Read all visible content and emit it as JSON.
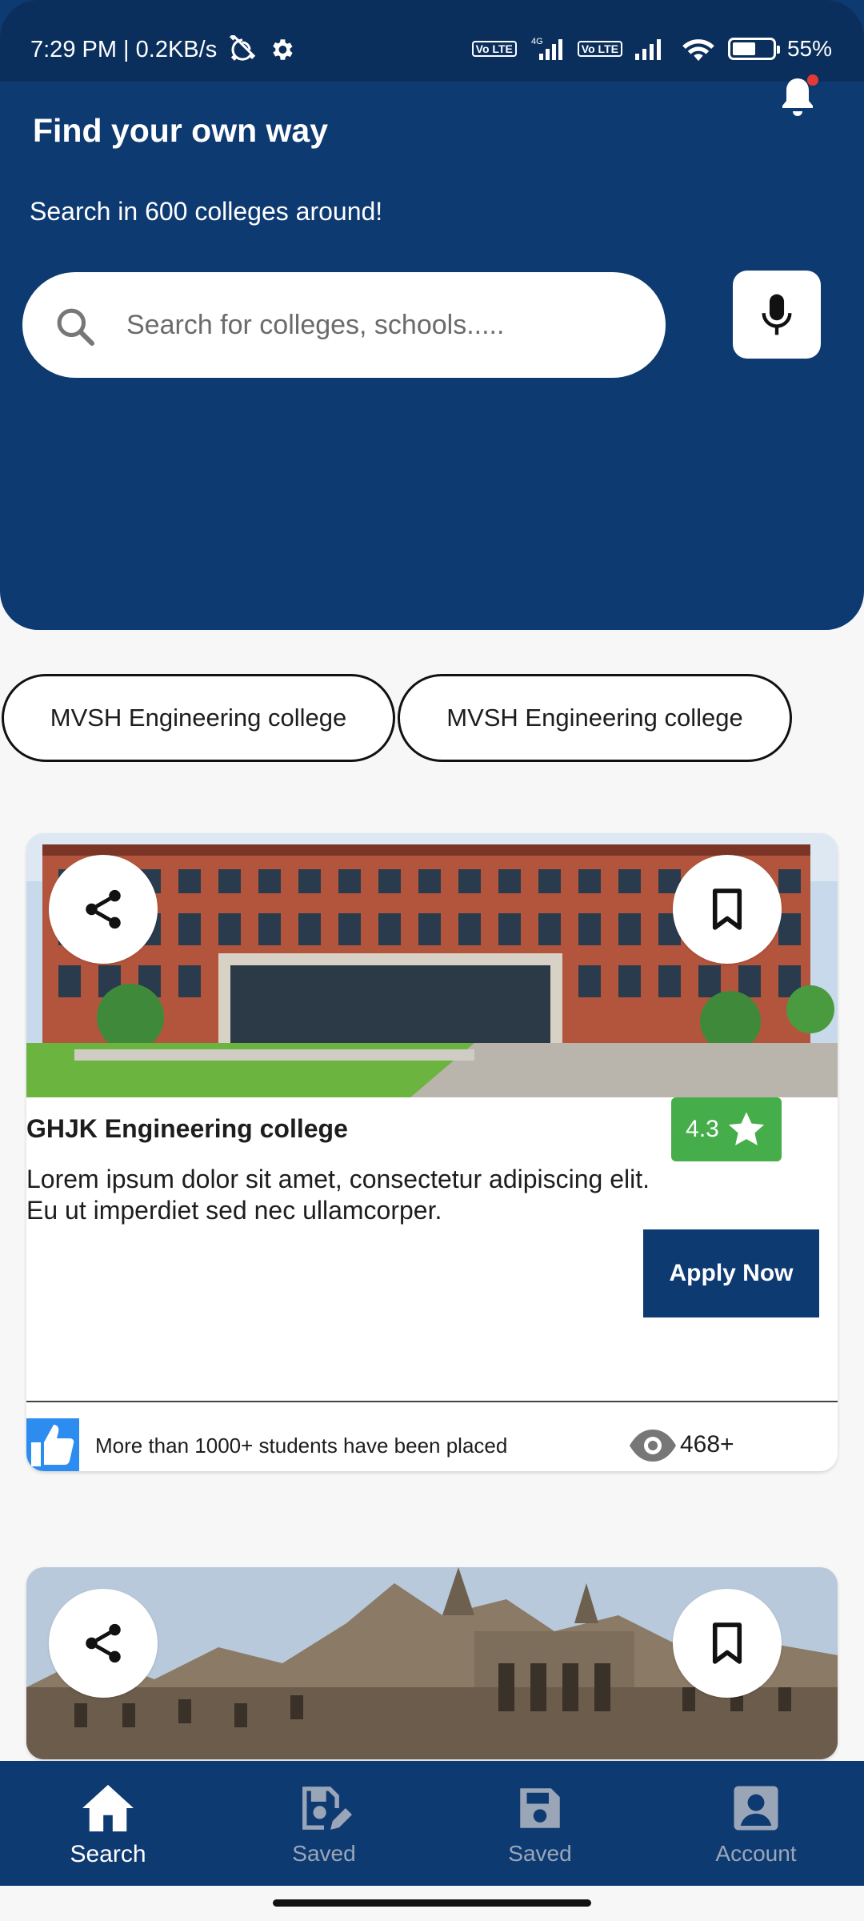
{
  "status_bar": {
    "time_speed": "7:29 PM | 0.2KB/s",
    "network_4g": "4G",
    "volte_1": "Vo LTE",
    "volte_2": "Vo LTE",
    "battery_percent": "55%",
    "battery_level": 0.55
  },
  "header": {
    "title": "Find your own way",
    "subtitle": "Search in 600 colleges around!",
    "search_placeholder": "Search for colleges, schools.....",
    "background_color": "#0e3a72"
  },
  "chips": [
    {
      "label": "MVSH Engineering college"
    },
    {
      "label": "MVSH Engineering college"
    }
  ],
  "cards": [
    {
      "name": "GHJK Engineering college",
      "rating": "4.3",
      "description": "Lorem ipsum dolor sit amet, consectetur adipiscing elit. Eu ut imperdiet sed nec ullamcorper.",
      "apply_label": "Apply Now",
      "placed_text": "More than 1000+ students have been placed",
      "views": "468+"
    },
    {
      "name": "",
      "rating": "",
      "description": ""
    }
  ],
  "bottom_nav": {
    "items": [
      {
        "label": "Search",
        "icon": "home-icon",
        "active": true
      },
      {
        "label": "Saved",
        "icon": "saved-edit-icon",
        "active": false
      },
      {
        "label": "Saved",
        "icon": "save-disk-icon",
        "active": false
      },
      {
        "label": "Account",
        "icon": "account-icon",
        "active": false
      }
    ]
  },
  "colors": {
    "primary": "#0e3a72",
    "rating_green": "#46ad4b",
    "like_blue": "#2d8cf0"
  }
}
